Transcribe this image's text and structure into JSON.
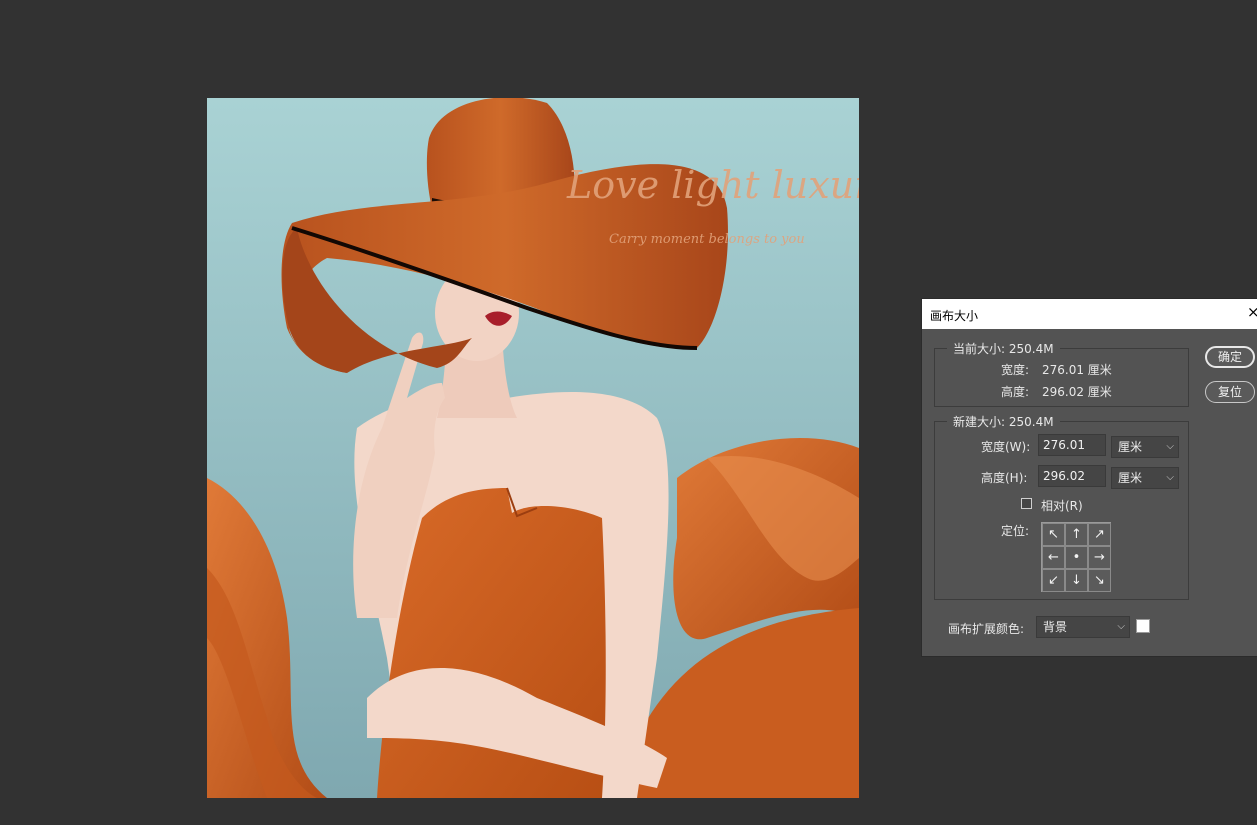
{
  "artwork": {
    "title_text": "Love light luxury",
    "subtitle_text": "Carry moment belongs to you",
    "colors": {
      "background": "#a8cdd0",
      "hat": "#c85a1e",
      "dress": "#d25a18",
      "skin": "#f2d6c8"
    }
  },
  "dialog": {
    "title": "画布大小",
    "close_icon": "×",
    "ok_label": "确定",
    "reset_label": "复位",
    "current": {
      "header": "当前大小: 250.4M",
      "width_label": "宽度:",
      "width_value": "276.01 厘米",
      "height_label": "高度:",
      "height_value": "296.02 厘米"
    },
    "new": {
      "header": "新建大小: 250.4M",
      "width_label": "宽度(W):",
      "width_value": "276.01",
      "width_unit": "厘米",
      "height_label": "高度(H):",
      "height_value": "296.02",
      "height_unit": "厘米",
      "relative_label": "相对(R)",
      "relative_checked": false,
      "anchor_label": "定位:",
      "anchor_arrows": [
        "↖",
        "↑",
        "↗",
        "←",
        "•",
        "→",
        "↙",
        "↓",
        "↘"
      ]
    },
    "extension_label": "画布扩展颜色:",
    "extension_value": "背景",
    "extension_color": "#ffffff"
  }
}
